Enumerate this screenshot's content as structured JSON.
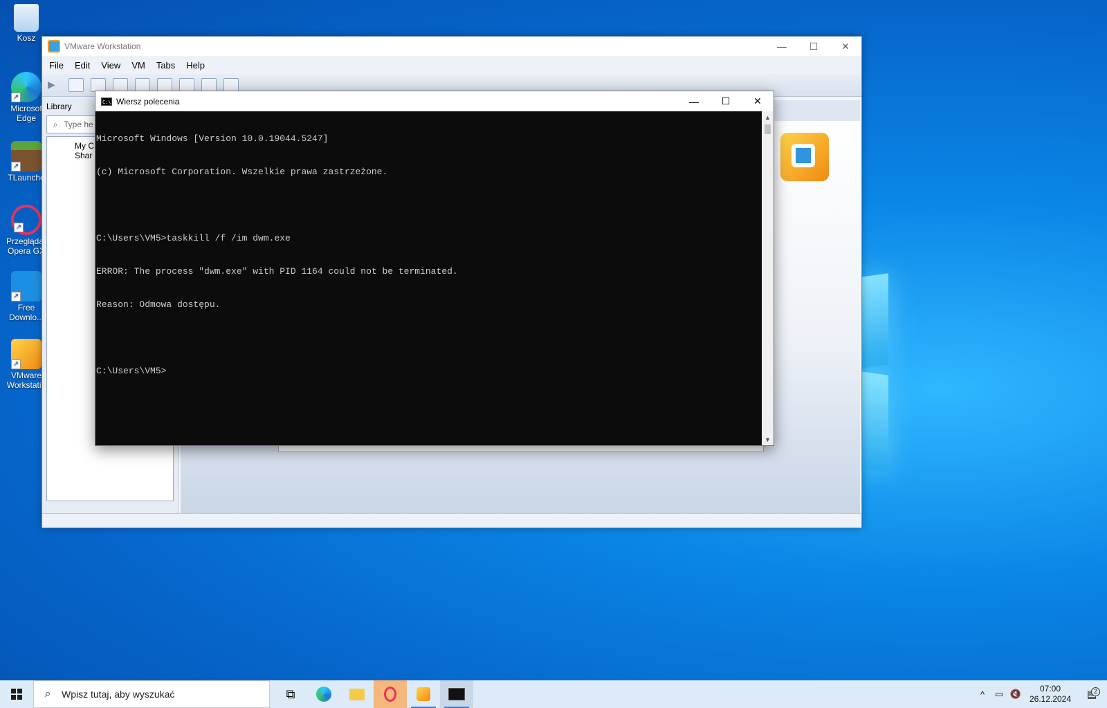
{
  "desktop": {
    "icons": [
      {
        "label": "Kosz",
        "icon": "recycle-bin-icon"
      },
      {
        "label": "Microsoft Edge",
        "icon": "edge-icon"
      },
      {
        "label": "TLauncher",
        "icon": "tlauncher-icon"
      },
      {
        "label": "Przeglądarka Opera GX",
        "icon": "opera-gx-icon"
      },
      {
        "label": "Free Downlo...",
        "icon": "free-download-manager-icon"
      },
      {
        "label": "VMware Workstation",
        "icon": "vmware-icon"
      }
    ],
    "icon_labels_visible": [
      "Kosz",
      "Microsof\nEdge",
      "TLaunche",
      "Przeglądar\nOpera GX",
      "Free\nDownlo...",
      "VMware\nWorkstatio"
    ]
  },
  "vmware": {
    "title": "VMware Workstation",
    "menu": [
      "File",
      "Edit",
      "View",
      "VM",
      "Tabs",
      "Help"
    ],
    "library_label": "Library",
    "search_placeholder": "Type he",
    "tree": [
      "My C",
      "Shar"
    ]
  },
  "cmd": {
    "title": "Wiersz polecenia",
    "lines": [
      "Microsoft Windows [Version 10.0.19044.5247]",
      "(c) Microsoft Corporation. Wszelkie prawa zastrzeżone.",
      "",
      "C:\\Users\\VM5>taskkill /f /im dwm.exe",
      "ERROR: The process \"dwm.exe\" with PID 1164 could not be terminated.",
      "Reason: Odmowa dostępu.",
      "",
      "C:\\Users\\VM5>"
    ],
    "background": "#0c0c0c",
    "foreground": "#cccccc"
  },
  "taskbar": {
    "search_placeholder": "Wpisz tutaj, aby wyszukać",
    "apps": [
      {
        "name": "task-view-icon",
        "glyph": "⧉"
      },
      {
        "name": "edge-icon",
        "glyph": "◐"
      },
      {
        "name": "file-explorer-icon",
        "glyph": "▭"
      },
      {
        "name": "opera-gx-icon",
        "glyph": "O"
      },
      {
        "name": "vmware-icon",
        "glyph": "▣"
      },
      {
        "name": "cmd-icon",
        "glyph": "C:\\"
      }
    ],
    "time": "07:00",
    "date": "26.12.2024",
    "notifications": "2"
  }
}
